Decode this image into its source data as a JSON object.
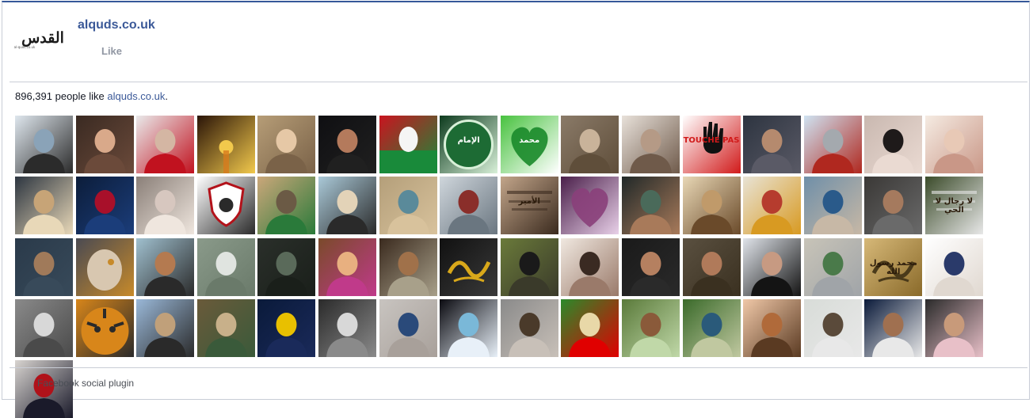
{
  "header": {
    "logo_text": "القدس",
    "logo_subtext": "al-quds.co.uk",
    "page_name": "alquds.co.uk",
    "like_label": "Like"
  },
  "social": {
    "count": "896,391",
    "people_like_text": " people like ",
    "page_link": "alquds.co.uk",
    "period": "."
  },
  "fans": [
    {
      "label": "",
      "colors": [
        "#dfe7ee",
        "#8aa3b8",
        "#2b2b2b"
      ],
      "accent": ""
    },
    {
      "label": "",
      "colors": [
        "#3a2a22",
        "#d9a98a",
        "#6b4a3a"
      ],
      "accent": ""
    },
    {
      "label": "",
      "colors": [
        "#e9e9ea",
        "#d4b6a3",
        "#c1121f"
      ],
      "accent": ""
    },
    {
      "label": "",
      "colors": [
        "#2a1408",
        "#d77b1d",
        "#f2c94c"
      ],
      "accent": "sunset"
    },
    {
      "label": "",
      "colors": [
        "#b69d77",
        "#e6c8a6",
        "#7a6248"
      ],
      "accent": ""
    },
    {
      "label": "",
      "colors": [
        "#0f0f12",
        "#b47a5c",
        "#202020"
      ],
      "accent": ""
    },
    {
      "label": "",
      "colors": [
        "#c9141f",
        "#f5f5f5",
        "#198a3a"
      ],
      "accent": "flag"
    },
    {
      "label": "الإمام",
      "colors": [
        "#0d3b1e",
        "#1d6b34",
        "#d8f0d8"
      ],
      "accent": "circle"
    },
    {
      "label": "محمد",
      "colors": [
        "#48c23f",
        "#198a2a",
        "#ffffff"
      ],
      "accent": "heart"
    },
    {
      "label": "",
      "colors": [
        "#8a7a68",
        "#c9b39a",
        "#5f4e3a"
      ],
      "accent": ""
    },
    {
      "label": "",
      "colors": [
        "#e8e1da",
        "#b59a86",
        "#6f5a4a"
      ],
      "accent": ""
    },
    {
      "label": "TOUCHE PAS",
      "colors": [
        "#ffffff",
        "#111111",
        "#d11a1a"
      ],
      "accent": "hand"
    },
    {
      "label": "",
      "colors": [
        "#2d3440",
        "#b58a6e",
        "#5a5a66"
      ],
      "accent": ""
    },
    {
      "label": "",
      "colors": [
        "#cfe3f2",
        "#a4a9ae",
        "#b0281f"
      ],
      "accent": ""
    },
    {
      "label": "",
      "colors": [
        "#c9b8b0",
        "#1e1a1a",
        "#eadad2"
      ],
      "accent": ""
    },
    {
      "label": "",
      "colors": [
        "#f5ebe2",
        "#e8c9b6",
        "#c99787"
      ],
      "accent": ""
    },
    {
      "label": "",
      "colors": [
        "#2c3540",
        "#c7a477",
        "#e8d8b8"
      ],
      "accent": ""
    },
    {
      "label": "",
      "colors": [
        "#0c1d3a",
        "#a8102a",
        "#1b3d7a"
      ],
      "accent": ""
    },
    {
      "label": "",
      "colors": [
        "#8a7f78",
        "#d7c7bf",
        "#efe6de"
      ],
      "accent": ""
    },
    {
      "label": "",
      "colors": [
        "#ffffff",
        "#b3121a",
        "#2a2a2a"
      ],
      "accent": "shield"
    },
    {
      "label": "",
      "colors": [
        "#cba77a",
        "#6b5a45",
        "#2a7a3a"
      ],
      "accent": ""
    },
    {
      "label": "",
      "colors": [
        "#aac9d8",
        "#e3d3b8",
        "#2a2a2a"
      ],
      "accent": ""
    },
    {
      "label": "",
      "colors": [
        "#b49f7a",
        "#5a8a9a",
        "#d8c29c"
      ],
      "accent": ""
    },
    {
      "label": "",
      "colors": [
        "#cfd6dc",
        "#8a2e2a",
        "#6a7680"
      ],
      "accent": ""
    },
    {
      "label": "الأمير",
      "colors": [
        "#c2a58a",
        "#7a5b42",
        "#3a2a1e"
      ],
      "accent": "text"
    },
    {
      "label": "",
      "colors": [
        "#4a1f4a",
        "#8a3f7a",
        "#e8d0e8"
      ],
      "accent": "heart2"
    },
    {
      "label": "",
      "colors": [
        "#202828",
        "#4a6a5a",
        "#a87a5a"
      ],
      "accent": ""
    },
    {
      "label": "",
      "colors": [
        "#e8d7b5",
        "#c09a6a",
        "#6a4a2a"
      ],
      "accent": ""
    },
    {
      "label": "",
      "colors": [
        "#e8e3d5",
        "#b63c2e",
        "#d89a22"
      ],
      "accent": ""
    },
    {
      "label": "",
      "colors": [
        "#6f8fa8",
        "#2a5a8a",
        "#c7b8a6"
      ],
      "accent": ""
    },
    {
      "label": "",
      "colors": [
        "#3a3836",
        "#a57a5e",
        "#6a6a6a"
      ],
      "accent": ""
    },
    {
      "label": "لا رجال لا الحي",
      "colors": [
        "#3b4b2a",
        "#1a2410",
        "#e8e8e8"
      ],
      "accent": "text"
    },
    {
      "label": "",
      "colors": [
        "#2a3a4a",
        "#a07a5a",
        "#384a5a"
      ],
      "accent": ""
    },
    {
      "label": "",
      "colors": [
        "#4a4a52",
        "#d8c7b0",
        "#c78a2a"
      ],
      "accent": "bird"
    },
    {
      "label": "",
      "colors": [
        "#a0c0cf",
        "#b47a50",
        "#2a2a2a"
      ],
      "accent": ""
    },
    {
      "label": "",
      "colors": [
        "#8a9a8a",
        "#e0e4e0",
        "#6a7a6a"
      ],
      "accent": ""
    },
    {
      "label": "",
      "colors": [
        "#2a2f2a",
        "#5a6a5a",
        "#1a1f1a"
      ],
      "accent": ""
    },
    {
      "label": "",
      "colors": [
        "#7a4a2a",
        "#e8b080",
        "#c03a8a"
      ],
      "accent": ""
    },
    {
      "label": "",
      "colors": [
        "#3a2a1e",
        "#a0714a",
        "#a8a08a"
      ],
      "accent": ""
    },
    {
      "label": "",
      "colors": [
        "#111111",
        "#d9a81a",
        "#3a3a3a"
      ],
      "accent": "calli"
    },
    {
      "label": "",
      "colors": [
        "#6a7a3a",
        "#1a1a1a",
        "#3a3a2a"
      ],
      "accent": ""
    },
    {
      "label": "",
      "colors": [
        "#f0e8e0",
        "#3a2a22",
        "#9a7a6a"
      ],
      "accent": ""
    },
    {
      "label": "",
      "colors": [
        "#1a1a1a",
        "#b58060",
        "#2a2a2a"
      ],
      "accent": ""
    },
    {
      "label": "",
      "colors": [
        "#5a5040",
        "#b07a5a",
        "#3a3020"
      ],
      "accent": ""
    },
    {
      "label": "",
      "colors": [
        "#e0e4ea",
        "#c79a82",
        "#141414"
      ],
      "accent": ""
    },
    {
      "label": "",
      "colors": [
        "#c8c4b8",
        "#4a7a4a",
        "#a0a4a8"
      ],
      "accent": ""
    },
    {
      "label": "محمد رسول الله",
      "colors": [
        "#d6b878",
        "#4a3a1a",
        "#8a6a2a"
      ],
      "accent": "calli2"
    },
    {
      "label": "",
      "colors": [
        "#ffffff",
        "#2a3a6a",
        "#e0d8d0"
      ],
      "accent": ""
    },
    {
      "label": "",
      "colors": [
        "#8a8a8a",
        "#d8d8d8",
        "#4a4a4a"
      ],
      "accent": ""
    },
    {
      "label": "",
      "colors": [
        "#d8861a",
        "#f2e8d8",
        "#2a2a2a"
      ],
      "accent": "tiger"
    },
    {
      "label": "",
      "colors": [
        "#9ab8d8",
        "#c0a07a",
        "#2a2a2a"
      ],
      "accent": ""
    },
    {
      "label": "",
      "colors": [
        "#6a5a3a",
        "#c8b08a",
        "#3a5a3a"
      ],
      "accent": ""
    },
    {
      "label": "",
      "colors": [
        "#0a1a3a",
        "#e8c000",
        "#1a2a5a"
      ],
      "accent": ""
    },
    {
      "label": "",
      "colors": [
        "#2a2a2a",
        "#d8d8d8",
        "#8a8a8a"
      ],
      "accent": ""
    },
    {
      "label": "",
      "colors": [
        "#c8c4c0",
        "#2a4a7a",
        "#a8a09a"
      ],
      "accent": ""
    },
    {
      "label": "",
      "colors": [
        "#0a0a10",
        "#7ab8d8",
        "#e8f0f8"
      ],
      "accent": ""
    },
    {
      "label": "",
      "colors": [
        "#8a8a8a",
        "#4a3a2a",
        "#c8c0b8"
      ],
      "accent": ""
    },
    {
      "label": "",
      "colors": [
        "#2a8a2a",
        "#e8d8a8",
        "#e00000"
      ],
      "accent": ""
    },
    {
      "label": "",
      "colors": [
        "#5a7a3a",
        "#8a5a3a",
        "#c0d8a8"
      ],
      "accent": ""
    },
    {
      "label": "",
      "colors": [
        "#3a6a2a",
        "#2a5a7a",
        "#c0c8a0"
      ],
      "accent": ""
    },
    {
      "label": "",
      "colors": [
        "#f0c8a8",
        "#b06a3a",
        "#5a3a22"
      ],
      "accent": ""
    },
    {
      "label": "",
      "colors": [
        "#d8dcd8",
        "#5a4a3a",
        "#e8e8e8"
      ],
      "accent": ""
    },
    {
      "label": "",
      "colors": [
        "#0a1a3a",
        "#a07050",
        "#e8e8e8"
      ],
      "accent": ""
    },
    {
      "label": "",
      "colors": [
        "#2a2a2a",
        "#c89a7a",
        "#e8c0c8"
      ],
      "accent": ""
    },
    {
      "label": "",
      "colors": [
        "#d8d4d0",
        "#b0121a",
        "#1a1a2a"
      ],
      "accent": ""
    }
  ],
  "footer": {
    "label": "Facebook social plugin"
  }
}
